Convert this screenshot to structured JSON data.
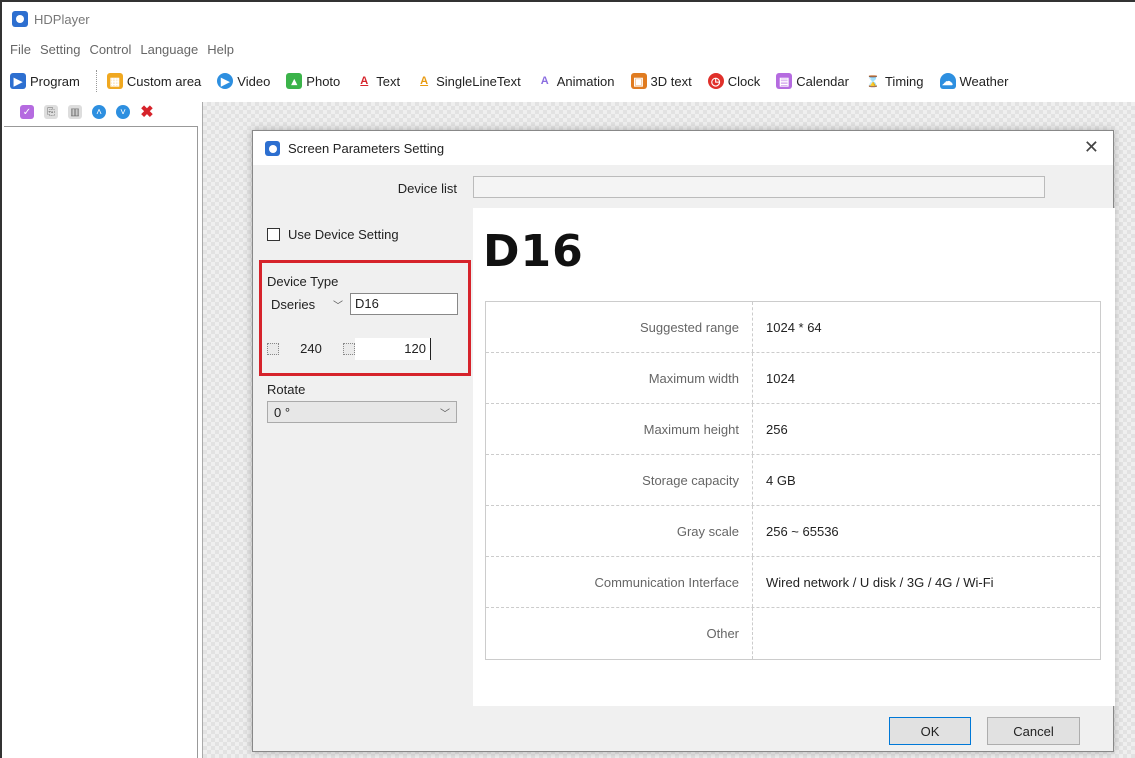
{
  "app": {
    "title": "HDPlayer"
  },
  "menu": [
    "File",
    "Setting",
    "Control",
    "Language",
    "Help"
  ],
  "toolbar": [
    {
      "label": "Program",
      "icon": "program-icon",
      "color": "#2d6fd0"
    },
    {
      "label": "Custom area",
      "icon": "custom-area-icon",
      "color": "#f0a820"
    },
    {
      "label": "Video",
      "icon": "video-icon",
      "color": "#2d8fe0"
    },
    {
      "label": "Photo",
      "icon": "photo-icon",
      "color": "#3bb34a"
    },
    {
      "label": "Text",
      "icon": "text-icon",
      "color": "#d6232b"
    },
    {
      "label": "SingleLineText",
      "icon": "single-line-text-icon",
      "color": "#e89a10"
    },
    {
      "label": "Animation",
      "icon": "animation-icon",
      "color": "#8a6de0"
    },
    {
      "label": "3D text",
      "icon": "3d-text-icon",
      "color": "#e07b20"
    },
    {
      "label": "Clock",
      "icon": "clock-icon",
      "color": "#e0302a"
    },
    {
      "label": "Calendar",
      "icon": "calendar-icon",
      "color": "#b56be0"
    },
    {
      "label": "Timing",
      "icon": "timing-icon",
      "color": "#8a6de0"
    },
    {
      "label": "Weather",
      "icon": "weather-icon",
      "color": "#2d8fe0"
    }
  ],
  "dialog": {
    "title": "Screen Parameters Setting",
    "device_list_label": "Device list",
    "use_device_setting": "Use Device Setting",
    "device_type_label": "Device Type",
    "series": "Dseries",
    "model_value": "D16",
    "width": "240",
    "height": "120",
    "rotate_label": "Rotate",
    "rotate_value": "0 °",
    "device_name": "D16",
    "specs": [
      {
        "key": "Suggested range",
        "value": "1024 * 64"
      },
      {
        "key": "Maximum width",
        "value": "1024"
      },
      {
        "key": "Maximum height",
        "value": "256"
      },
      {
        "key": "Storage capacity",
        "value": "4 GB"
      },
      {
        "key": "Gray scale",
        "value": "256 ~ 65536"
      },
      {
        "key": "Communication Interface",
        "value": "Wired network / U disk / 3G / 4G / Wi-Fi"
      },
      {
        "key": "Other",
        "value": ""
      }
    ],
    "ok_label": "OK",
    "cancel_label": "Cancel"
  },
  "colors": {
    "highlight": "#d6232b",
    "accent": "#0078d7"
  }
}
